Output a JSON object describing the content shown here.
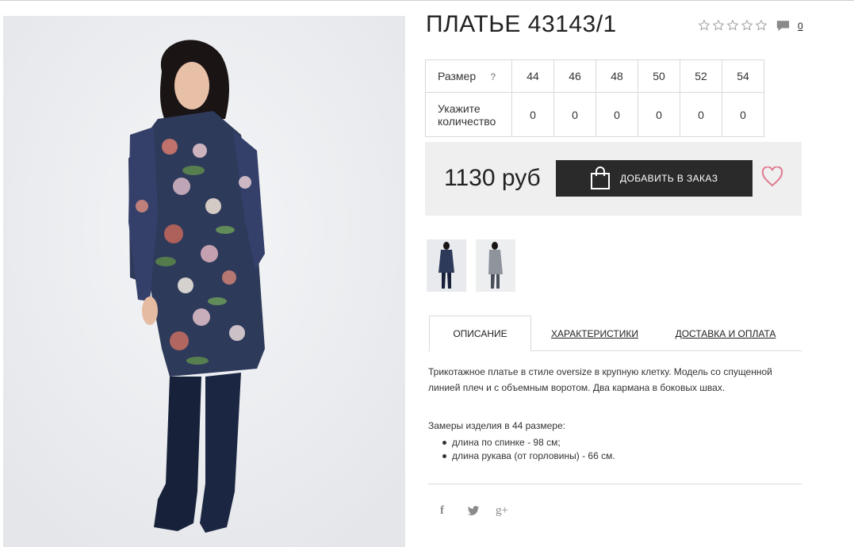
{
  "product": {
    "title": "ПЛАТЬЕ 43143/1",
    "rating_icon": "star-outline-icon",
    "rating_stars": 0,
    "comment_icon": "comment-icon",
    "comment_count": "0"
  },
  "sizes": {
    "size_label": "Размер",
    "help_mark": "?",
    "qty_label_line1": "Укажите",
    "qty_label_line2": "количество",
    "items": [
      {
        "size": "44",
        "qty": "0"
      },
      {
        "size": "46",
        "qty": "0"
      },
      {
        "size": "48",
        "qty": "0"
      },
      {
        "size": "50",
        "qty": "0"
      },
      {
        "size": "52",
        "qty": "0"
      },
      {
        "size": "54",
        "qty": "0"
      }
    ]
  },
  "purchase": {
    "price": "1130 руб",
    "add_button_label": "ДОБАВИТЬ В ЗАКАЗ",
    "add_button_icon": "shopping-bag-icon",
    "wishlist_icon": "heart-icon",
    "accent_color": "#e07a8f",
    "button_color": "#2a2a2a"
  },
  "tabs": [
    {
      "label": "ОПИСАНИЕ",
      "active": true
    },
    {
      "label": "ХАРАКТЕРИСТИКИ",
      "active": false
    },
    {
      "label": "ДОСТАВКА И ОПЛАТА",
      "active": false
    }
  ],
  "description": {
    "text": "Трикотажное платье в стиле oversize в крупную клетку. Модель со спущенной линией плеч и с объемным воротом. Два кармана в боковых швах.",
    "measure_title": "Замеры изделия в 44 размере:",
    "measures": [
      "длина по спинке - 98 см;",
      "длина рукава (от горловины) - 66 см."
    ]
  },
  "social": {
    "facebook": "f",
    "twitter_icon": "twitter-icon",
    "google_plus": "g+"
  }
}
